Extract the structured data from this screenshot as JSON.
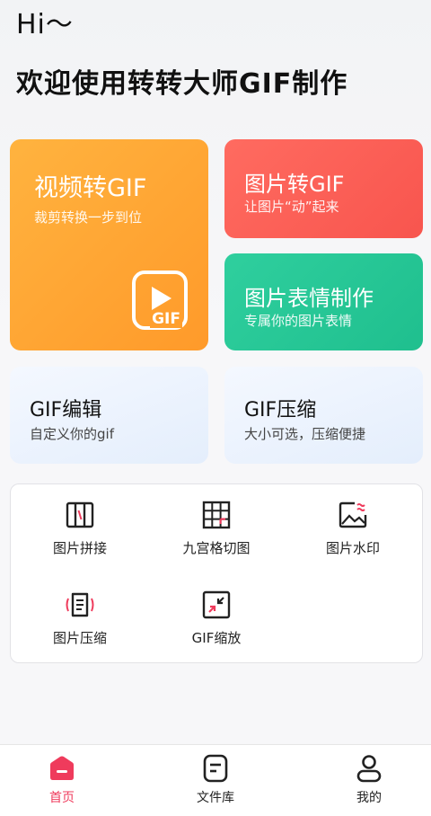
{
  "header": {
    "greeting": "Hi～",
    "welcome": "欢迎使用转转大师GIF制作"
  },
  "cards": {
    "video_to_gif": {
      "title": "视频转GIF",
      "subtitle": "裁剪转换一步到位",
      "badge": "GIF"
    },
    "image_to_gif": {
      "title": "图片转GIF",
      "subtitle": "让图片“动”起来"
    },
    "sticker_maker": {
      "title": "图片表情制作",
      "subtitle": "专属你的图片表情"
    },
    "gif_edit": {
      "title": "GIF编辑",
      "subtitle": "自定义你的gif"
    },
    "gif_compress": {
      "title": "GIF压缩",
      "subtitle": "大小可选，压缩便捷"
    }
  },
  "tools": [
    {
      "label": "图片拼接",
      "icon": "image-stitch-icon"
    },
    {
      "label": "九宫格切图",
      "icon": "grid-cut-icon"
    },
    {
      "label": "图片水印",
      "icon": "watermark-icon"
    },
    {
      "label": "图片压缩",
      "icon": "image-compress-icon"
    },
    {
      "label": "GIF缩放",
      "icon": "gif-scale-icon"
    }
  ],
  "tabbar": {
    "items": [
      {
        "label": "首页",
        "icon": "home-icon",
        "active": true
      },
      {
        "label": "文件库",
        "icon": "file-library-icon",
        "active": false
      },
      {
        "label": "我的",
        "icon": "profile-icon",
        "active": false
      }
    ]
  },
  "colors": {
    "accent": "#ef3b5c",
    "orange": "#ffa635",
    "red": "#f95e56",
    "green": "#26c796"
  }
}
